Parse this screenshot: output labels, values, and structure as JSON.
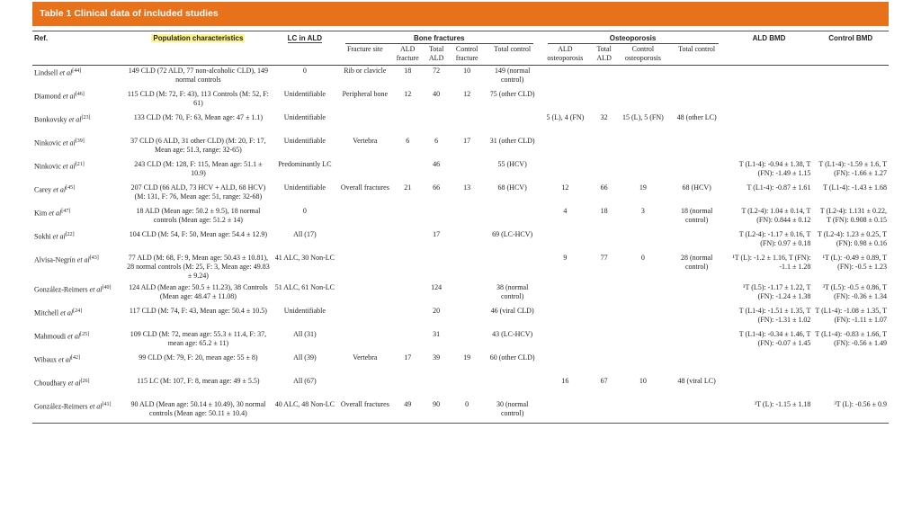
{
  "table_title": "Table 1  Clinical data of included studies",
  "headers": {
    "ref": "Ref.",
    "population": "Population characteristics",
    "lc_in_ald": "LC in ALD",
    "bone_fractures": "Bone fractures",
    "osteoporosis": "Osteoporosis",
    "ald_bmd": "ALD BMD",
    "control_bmd": "Control BMD",
    "fracture_site": "Fracture site",
    "ald_fracture": "ALD fracture",
    "total_ald_bf": "Total ALD",
    "control_fracture": "Control fracture",
    "total_control_bf": "Total control",
    "ald_osteoporosis": "ALD osteoporosis",
    "total_ald_op": "Total ALD",
    "control_osteoporosis": "Control osteoporosis",
    "total_control_op": "Total control"
  },
  "rows": [
    {
      "author": "Lindsell",
      "etal": " et al",
      "ref": "[44]",
      "pop": "149 CLD (72 ALD, 77 non-alcoholic CLD), 149 normal controls",
      "lc": "0",
      "site": "Rib or clavicle",
      "aldf": "18",
      "totald": "72",
      "ctrlf": "10",
      "totctrl": "149 (normal control)",
      "aldop": "",
      "totaldop": "",
      "ctrlop": "",
      "totctrlop": "",
      "aldbmd": "",
      "ctrlbmd": ""
    },
    {
      "author": "Diamond",
      "etal": " et al",
      "ref": "[46]",
      "pop": "115 CLD (M: 72, F: 43), 113 Controls (M: 52, F: 61)",
      "lc": "Unidentifiable",
      "site": "Peripheral bone",
      "aldf": "12",
      "totald": "40",
      "ctrlf": "12",
      "totctrl": "75 (other CLD)",
      "aldop": "",
      "totaldop": "",
      "ctrlop": "",
      "totctrlop": "",
      "aldbmd": "",
      "ctrlbmd": ""
    },
    {
      "author": "Bonkovsky",
      "etal": " et al",
      "ref": "[23]",
      "pop": "133 CLD (M: 70, F: 63, Mean age: 47 ± 1.1)",
      "lc": "Unidentifiable",
      "site": "",
      "aldf": "",
      "totald": "",
      "ctrlf": "",
      "totctrl": "",
      "aldop": "5 (L), 4 (FN)",
      "totaldop": "32",
      "ctrlop": "15 (L), 5 (FN)",
      "totctrlop": "48 (other LC)",
      "aldbmd": "",
      "ctrlbmd": ""
    },
    {
      "author": "Ninkovic",
      "etal": " et al",
      "ref": "[39]",
      "pop": "37 CLD (6 ALD, 31 other CLD) (M: 20, F: 17, Mean age: 51.3, range: 32-65)",
      "lc": "Unidentifiable",
      "site": "Vertebra",
      "aldf": "6",
      "totald": "6",
      "ctrlf": "17",
      "totctrl": "31 (other CLD)",
      "aldop": "",
      "totaldop": "",
      "ctrlop": "",
      "totctrlop": "",
      "aldbmd": "",
      "ctrlbmd": ""
    },
    {
      "author": "Ninkovic",
      "etal": " et al",
      "ref": "[21]",
      "pop": "243 CLD (M: 128, F: 115, Mean age: 51.1 ± 10.9)",
      "lc": "Predominantly LC",
      "site": "",
      "aldf": "",
      "totald": "46",
      "ctrlf": "",
      "totctrl": "55 (HCV)",
      "aldop": "",
      "totaldop": "",
      "ctrlop": "",
      "totctrlop": "",
      "aldbmd": "T (L1-4): -0.94 ± 1.38, T (FN): -1.49 ± 1.15",
      "ctrlbmd": "T (L1-4): -1.59 ± 1.6, T (FN): -1.66 ± 1.27"
    },
    {
      "author": "Carey",
      "etal": " et al",
      "ref": "[45]",
      "pop": "207 CLD (66 ALD, 73 HCV + ALD, 68 HCV) (M: 131, F: 76, Mean age: 51, range: 32-68)",
      "lc": "Unidentifiable",
      "site": "Overall fractures",
      "aldf": "21",
      "totald": "66",
      "ctrlf": "13",
      "totctrl": "68 (HCV)",
      "aldop": "12",
      "totaldop": "66",
      "ctrlop": "19",
      "totctrlop": "68 (HCV)",
      "aldbmd": "T (L1-4): -0.87 ± 1.61",
      "ctrlbmd": "T (L1-4): -1.43 ± 1.68"
    },
    {
      "author": "Kim",
      "etal": " et al",
      "ref": "[47]",
      "pop": "18 ALD (Mean age: 50.2 ± 9.5), 18 normal controls (Mean age: 51.2 ± 14)",
      "lc": "0",
      "site": "",
      "aldf": "",
      "totald": "",
      "ctrlf": "",
      "totctrl": "",
      "aldop": "4",
      "totaldop": "18",
      "ctrlop": "3",
      "totctrlop": "18 (normal control)",
      "aldbmd": "T (L2-4): 1.04 ± 0.14, T (FN): 0.844 ± 0.12",
      "ctrlbmd": "T (L2-4): 1.131 ± 0.22, T (FN): 0.908 ± 0.15"
    },
    {
      "author": "Sokhi",
      "etal": " et al",
      "ref": "[22]",
      "pop": "104 CLD (M: 54, F: 50, Mean age: 54.4 ± 12.9)",
      "lc": "All (17)",
      "site": "",
      "aldf": "",
      "totald": "17",
      "ctrlf": "",
      "totctrl": "69 (LC-HCV)",
      "aldop": "",
      "totaldop": "",
      "ctrlop": "",
      "totctrlop": "",
      "aldbmd": "T (L2-4): -1.17 ± 0.16, T (FN): 0.97 ± 0.18",
      "ctrlbmd": "T (L2-4): 1.23 ± 0.25, T (FN): 0.98 ± 0.16"
    },
    {
      "author": "Alvisa-Negrín",
      "etal": " et al",
      "ref": "[43]",
      "pop": "77 ALD (M: 68, F: 9, Mean age: 50.43 ± 10.81), 28 normal controls (M: 25, F: 3, Mean age: 49.83 ± 9.24)",
      "lc": "41 ALC, 30 Non-LC",
      "site": "",
      "aldf": "",
      "totald": "",
      "ctrlf": "",
      "totctrl": "",
      "aldop": "9",
      "totaldop": "77",
      "ctrlop": "0",
      "totctrlop": "28 (normal control)",
      "aldbmd": "¹T (L): -1.2 ± 1.16, T (FN): -1.1 ± 1.28",
      "ctrlbmd": "¹T (L): -0.49 ± 0.89, T (FN): -0.5 ± 1.23"
    },
    {
      "author": "González-Reimers",
      "etal": " et al",
      "ref": "[40]",
      "pop": "124 ALD (Mean age: 50.5 ± 11.23), 38 Controls (Mean age: 48.47 ± 11.08)",
      "lc": "51 ALC, 61 Non-LC",
      "site": "",
      "aldf": "",
      "totald": "124",
      "ctrlf": "",
      "totctrl": "38 (normal control)",
      "aldop": "",
      "totaldop": "",
      "ctrlop": "",
      "totctrlop": "",
      "aldbmd": "³T (L5): -1.17 ± 1.22, T (FN): -1.24 ± 1.38",
      "ctrlbmd": "³T (L5): -0.5 ± 0.86, T (FN): -0.36 ± 1.34"
    },
    {
      "author": "Mitchell",
      "etal": " et al",
      "ref": "[24]",
      "pop": "117 CLD (M: 74, F: 43, Mean age: 50.4 ± 10.5)",
      "lc": "Unidentifiable",
      "site": "",
      "aldf": "",
      "totald": "20",
      "ctrlf": "",
      "totctrl": "46 (viral CLD)",
      "aldop": "",
      "totaldop": "",
      "ctrlop": "",
      "totctrlop": "",
      "aldbmd": "T (L1-4): -1.51 ± 1.35, T (FN): -1.31 ± 1.02",
      "ctrlbmd": "T (L1-4): -1.08 ± 1.35, T (FN): -1.11 ± 1.07"
    },
    {
      "author": "Mahmoudi",
      "etal": " et al",
      "ref": "[25]",
      "pop": "109 CLD (M: 72, mean age: 55.3 ± 11.4, F: 37, mean age: 65.2 ± 11)",
      "lc": "All (31)",
      "site": "",
      "aldf": "",
      "totald": "31",
      "ctrlf": "",
      "totctrl": "43 (LC-HCV)",
      "aldop": "",
      "totaldop": "",
      "ctrlop": "",
      "totctrlop": "",
      "aldbmd": "T (L1-4): -0.34 ± 1.46, T (FN): -0.07 ± 1.45",
      "ctrlbmd": "T (L1-4): -0.83 ± 1.66, T (FN): -0.56 ± 1.49"
    },
    {
      "author": "Wibaux",
      "etal": " et al",
      "ref": "[42]",
      "pop": "99 CLD (M: 79, F: 20, mean age: 55 ± 8)",
      "lc": "All (39)",
      "site": "Vertebra",
      "aldf": "17",
      "totald": "39",
      "ctrlf": "19",
      "totctrl": "60 (other CLD)",
      "aldop": "",
      "totaldop": "",
      "ctrlop": "",
      "totctrlop": "",
      "aldbmd": "",
      "ctrlbmd": ""
    },
    {
      "author": "Choudhary",
      "etal": " et al",
      "ref": "[26]",
      "pop": "115 LC (M: 107, F: 8, mean age: 49 ± 5.5)",
      "lc": "All (67)",
      "site": "",
      "aldf": "",
      "totald": "",
      "ctrlf": "",
      "totctrl": "",
      "aldop": "16",
      "totaldop": "67",
      "ctrlop": "10",
      "totctrlop": "48 (viral LC)",
      "aldbmd": "",
      "ctrlbmd": ""
    },
    {
      "author": "González-Reimers",
      "etal": " et al",
      "ref": "[41]",
      "pop": "90 ALD (Mean age: 50.14 ± 10.49), 30 normal controls (Mean age: 50.11 ± 10.4)",
      "lc": "40 ALC, 48 Non-LC",
      "site": "Overall fractures",
      "aldf": "49",
      "totald": "90",
      "ctrlf": "0",
      "totctrl": "30 (normal control)",
      "aldop": "",
      "totaldop": "",
      "ctrlop": "",
      "totctrlop": "",
      "aldbmd": "³T (L): -1.15 ± 1.18",
      "ctrlbmd": "³T (L): -0.56 ± 0.9"
    }
  ]
}
